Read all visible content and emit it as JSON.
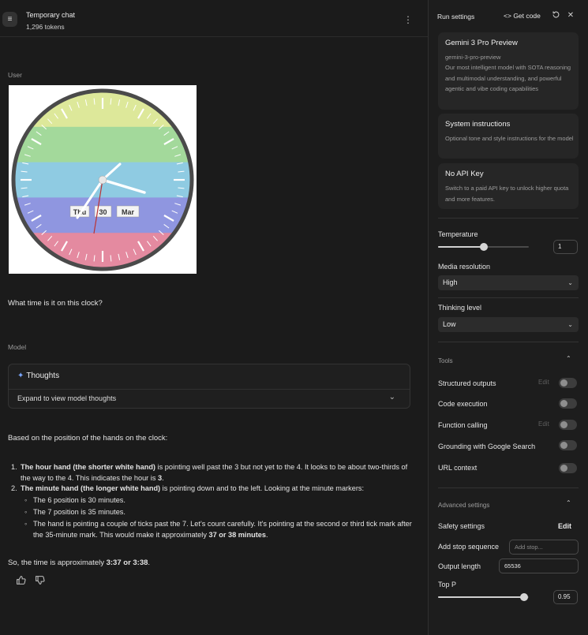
{
  "header": {
    "title": "Temporary chat",
    "tokens": "1,296 tokens"
  },
  "conversation": {
    "user_label": "User",
    "user_message": "What time is it on this clock?",
    "image": {
      "date_labels": [
        "Thu",
        "30",
        "Mar"
      ],
      "stripe_colors": [
        "#dde89a",
        "#a3d99b",
        "#8fcbe2",
        "#8f96e0",
        "#e48aa0"
      ]
    },
    "model_label": "Model",
    "thoughts": {
      "title": "Thoughts",
      "expand_label": "Expand to view model thoughts"
    },
    "answer": {
      "intro": "Based on the position of the hands on the clock:",
      "items": [
        {
          "number": "1.",
          "bold": "The hour hand (the shorter white hand)",
          "text": " is pointing well past the 3 but not yet to the 4. It looks to be about two-thirds of the way to the 4. This indicates the hour is ",
          "bold_end": "3",
          "text_end": "."
        },
        {
          "number": "2.",
          "bold": "The minute hand (the longer white hand)",
          "text": " is pointing down and to the left. Looking at the minute markers:",
          "subitems": [
            "The 6 position is 30 minutes.",
            "The 7 position is 35 minutes."
          ],
          "last_sub": {
            "text": "The hand is pointing a couple of ticks past the 7. Let's count carefully. It's pointing at the second or third tick mark after the 35-minute mark. This would make it approximately ",
            "bold": "37 or 38 minutes",
            "end": "."
          }
        }
      ],
      "final_prefix": "So, the time is approximately ",
      "final_bold": "3:37 or 3:38",
      "final_suffix": "."
    }
  },
  "settings": {
    "title": "Run settings",
    "get_code": "Get code",
    "model_card": {
      "name": "Gemini 3 Pro Preview",
      "id": "gemini-3-pro-preview",
      "description": "Our most intelligent model with SOTA reasoning and multimodal understanding, and powerful agentic and vibe coding capabilities"
    },
    "system_card": {
      "title": "System instructions",
      "description": "Optional tone and style instructions for the model"
    },
    "api_card": {
      "title": "No API Key",
      "description": "Switch to a paid API key to unlock higher quota and more features."
    },
    "temperature": {
      "label": "Temperature",
      "value": "1",
      "fraction": 0.5
    },
    "media_resolution": {
      "label": "Media resolution",
      "value": "High"
    },
    "thinking_level": {
      "label": "Thinking level",
      "value": "Low"
    },
    "tools": {
      "title": "Tools",
      "items": [
        {
          "label": "Structured outputs",
          "edit": "Edit",
          "enabled": false
        },
        {
          "label": "Code execution",
          "enabled": false
        },
        {
          "label": "Function calling",
          "edit": "Edit",
          "enabled": false
        },
        {
          "label": "Grounding with Google Search",
          "enabled": false
        },
        {
          "label": "URL context",
          "enabled": false
        }
      ]
    },
    "advanced": {
      "title": "Advanced settings",
      "safety_label": "Safety settings",
      "safety_edit": "Edit",
      "stop_label": "Add stop sequence",
      "stop_placeholder": "Add stop...",
      "output_label": "Output length",
      "output_value": "65536",
      "top_p_label": "Top P",
      "top_p_value": "0.95",
      "top_p_fraction": 0.95
    }
  },
  "colors": {
    "background": "#1b1b1b",
    "panel": "#1d1d1d",
    "card": "#262626",
    "accent": "#7aa7ff"
  }
}
